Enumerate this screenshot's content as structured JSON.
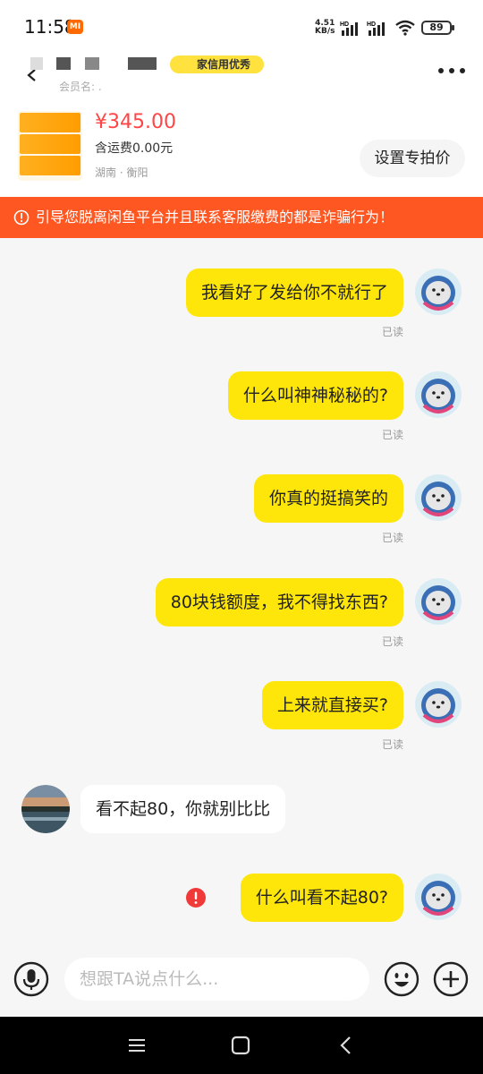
{
  "status_bar": {
    "time": "11:58",
    "carrier_badge": "MI",
    "net_speed_value": "4.51",
    "net_speed_unit": "KB/s",
    "signal_label": "HD",
    "battery": "89"
  },
  "header": {
    "credit_badge": "家信用优秀",
    "sub_name": "会员名: ."
  },
  "product": {
    "price": "¥345.00",
    "shipping": "含运费0.00元",
    "location": "湖南 · 衡阳",
    "set_price_label": "设置专拍价"
  },
  "warning": {
    "text": "引导您脱离闲鱼平台并且联系客服缴费的都是诈骗行为！"
  },
  "messages": [
    {
      "side": "out",
      "text": "我看好了发给你不就行了",
      "read": "已读"
    },
    {
      "side": "out",
      "text": "什么叫神神秘秘的?",
      "read": "已读"
    },
    {
      "side": "out",
      "text": "你真的挺搞笑的",
      "read": "已读"
    },
    {
      "side": "out",
      "text": "80块钱额度，我不得找东西?",
      "read": "已读"
    },
    {
      "side": "out",
      "text": "上来就直接买?",
      "read": "已读"
    },
    {
      "side": "in",
      "text": "看不起80，你就别比比"
    },
    {
      "side": "out",
      "text": "什么叫看不起80?",
      "failed": true
    }
  ],
  "input": {
    "placeholder": "想跟TA说点什么..."
  },
  "colors": {
    "accent_yellow": "#ffe60a",
    "price_red": "#ff4545",
    "warning_orange": "#ff5722"
  },
  "icons": [
    "back-icon",
    "more-icon",
    "warning-icon",
    "error-icon",
    "mic-icon",
    "emoji-icon",
    "plus-icon",
    "menu-icon",
    "home-icon",
    "back-nav-icon"
  ]
}
